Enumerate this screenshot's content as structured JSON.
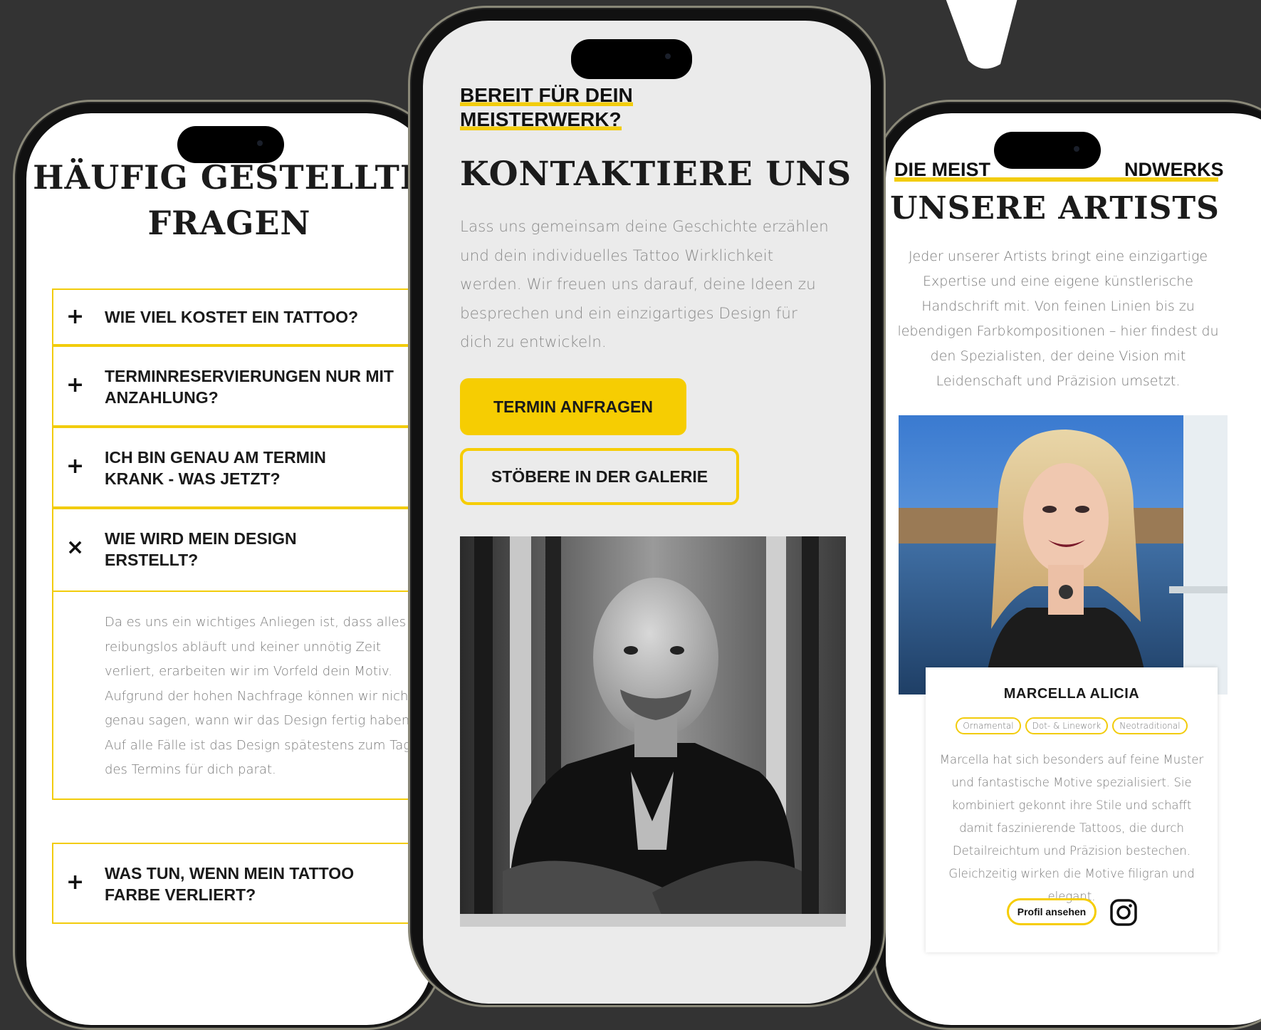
{
  "faq": {
    "title_line1": "HÄUFIG GESTELLTE",
    "title_line2": "FRAGEN",
    "items": [
      {
        "icon": "+",
        "question": "WIE VIEL KOSTET EIN TATTOO?"
      },
      {
        "icon": "+",
        "question": "TERMINRESERVIERUNGEN NUR MIT ANZAHLUNG?"
      },
      {
        "icon": "+",
        "question": "ICH BIN GENAU AM TERMIN KRANK - WAS JETZT?"
      },
      {
        "icon": "×",
        "question": "WIE WIRD MEIN DESIGN ERSTELLT?",
        "answer": "Da es uns ein wichtiges Anliegen ist, dass alles reibungslos abläuft und keiner unnötig Zeit verliert, erarbeiten wir im Vorfeld dein Motiv. Aufgrund der hohen Nachfrage können wir nicht genau sagen, wann wir das Design fertig haben. Auf alle Fälle ist das Design spätestens zum Tag des Termins für dich parat."
      },
      {
        "icon": "+",
        "question": "WAS TUN, WENN MEIN TATTOO FARBE VERLIERT?"
      }
    ]
  },
  "contact": {
    "kicker_line1": "BEREIT FÜR DEIN",
    "kicker_line2": "MEISTERWERK?",
    "title": "KONTAKTIERE UNS",
    "text": "Lass uns gemeinsam deine Geschichte erzählen und dein individuelles Tattoo Wirklichkeit werden. Wir freuen uns darauf, deine Ideen zu besprechen und ein einzigartiges Design für dich zu entwickeln.",
    "primary_button": "TERMIN ANFRAGEN",
    "secondary_button": "STÖBERE IN DER GALERIE"
  },
  "artists": {
    "kicker_left": "DIE MEIST",
    "kicker_right": "NDWERKS",
    "title": "UNSERE ARTISTS",
    "text": "Jeder unserer Artists bringt eine einzigartige Expertise und eine eigene künstlerische Handschrift mit. Von feinen Linien bis zu lebendigen Farbkompositionen – hier findest du den Spezialisten, der deine Vision mit Leidenschaft und Präzision umsetzt.",
    "card": {
      "name": "MARCELLA ALICIA",
      "tags": [
        "Ornamental",
        "Dot- & Linework",
        "Neotraditional"
      ],
      "bio": "Marcella hat sich besonders auf feine Muster und fantastische Motive spezialisiert. Sie kombiniert gekonnt ihre Stile und schafft damit faszinierende Tattoos, die durch Detailreichtum und Präzision bestechen. Gleichzeitig wirken die Motive filigran und elegant.",
      "profile_button": "Profil ansehen",
      "instagram_icon": "instagram-icon"
    }
  },
  "colors": {
    "accent": "#f6cd02",
    "background": "#333333"
  }
}
